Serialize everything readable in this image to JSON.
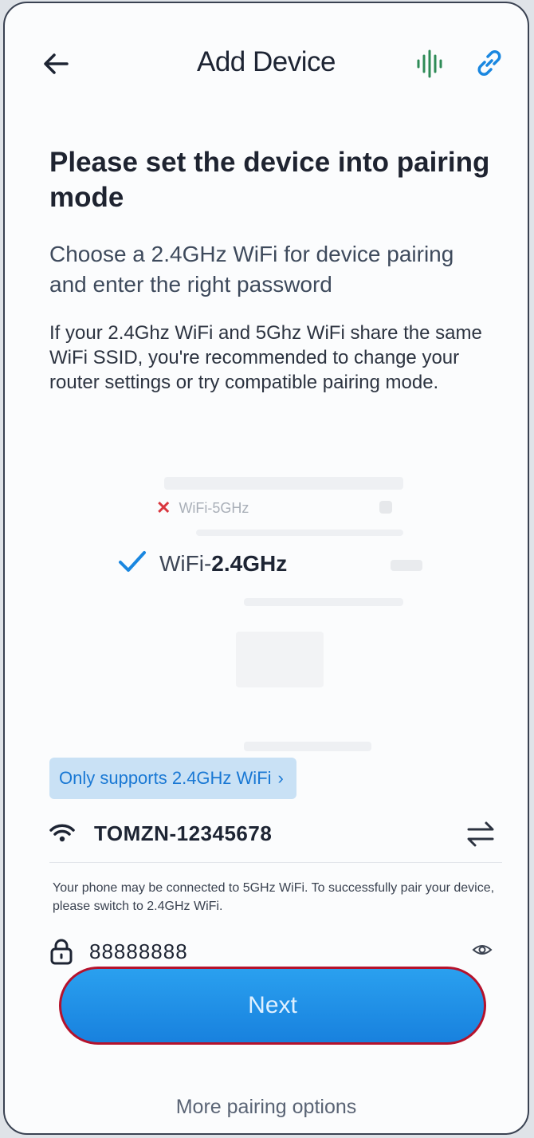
{
  "header": {
    "title": "Add Device",
    "icons": {
      "back": "arrow-left-icon",
      "voice": "sound-wave-icon",
      "link": "link-icon"
    }
  },
  "content": {
    "heading": "Please set the device into pairing mode",
    "subheading": "Choose a 2.4GHz WiFi for device pairing and enter the right password",
    "notice": "If your 2.4Ghz WiFi and 5Ghz WiFi share the same WiFi SSID, you're recommended to change your router settings or try compatible pairing mode."
  },
  "illustration": {
    "wifi_5g_label": "WiFi-5GHz",
    "wifi_24g_prefix": "WiFi-",
    "wifi_24g_bold": "2.4GHz"
  },
  "badge": {
    "label": "Only supports 2.4GHz WiFi",
    "chevron": "›"
  },
  "wifi": {
    "ssid": "TOMZN-12345678",
    "warning": "Your phone may be connected to 5GHz WiFi. To successfully pair your device, please switch to 2.4GHz WiFi."
  },
  "password": {
    "value": "88888888"
  },
  "actions": {
    "next_label": "Next",
    "more_label": "More pairing options"
  },
  "colors": {
    "accent": "#1a87e0",
    "error": "#d9363e",
    "voice_icon": "#2e8b57"
  }
}
